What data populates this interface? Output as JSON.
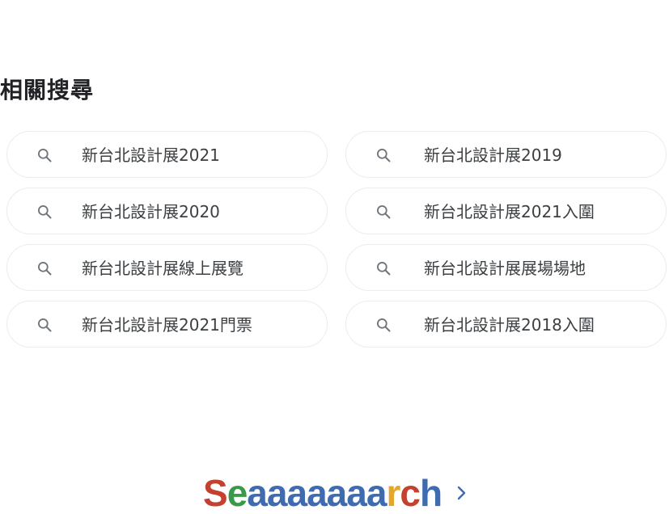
{
  "section": {
    "title": "相關搜尋"
  },
  "related_searches": [
    {
      "label": "新台北設計展2021"
    },
    {
      "label": "新台北設計展2019"
    },
    {
      "label": "新台北設計展2020"
    },
    {
      "label": "新台北設計展2021入圍"
    },
    {
      "label": "新台北設計展線上展覽"
    },
    {
      "label": "新台北設計展展場場地"
    },
    {
      "label": "新台北設計展2021門票"
    },
    {
      "label": "新台北設計展2018入圍"
    }
  ],
  "pagination": {
    "logo_letters": [
      {
        "char": "S",
        "color": "#c5412f"
      },
      {
        "char": "e",
        "color": "#3b9a4a"
      },
      {
        "char": "a",
        "color": "#3f6bb0"
      },
      {
        "char": "a",
        "color": "#3f6bb0"
      },
      {
        "char": "a",
        "color": "#3f6bb0"
      },
      {
        "char": "a",
        "color": "#3f6bb0"
      },
      {
        "char": "a",
        "color": "#3f6bb0"
      },
      {
        "char": "a",
        "color": "#3f6bb0"
      },
      {
        "char": "a",
        "color": "#3f6bb0"
      },
      {
        "char": "r",
        "color": "#e5a72b"
      },
      {
        "char": "c",
        "color": "#c5412f"
      },
      {
        "char": "h",
        "color": "#3f6bb0"
      }
    ],
    "next_icon": "chevron-right-icon",
    "icon_color": "#3f6bb0"
  },
  "colors": {
    "chip_border": "#ececec",
    "text": "#3c4043",
    "icon": "#70757a"
  }
}
